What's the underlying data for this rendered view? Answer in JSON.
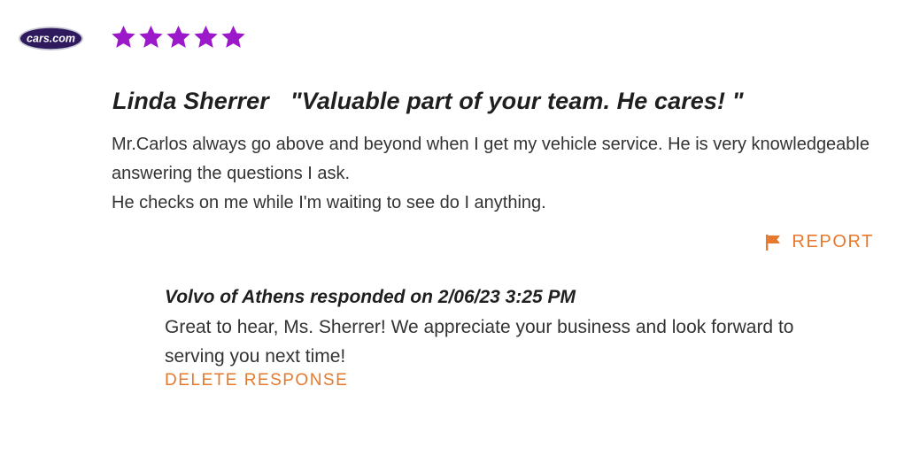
{
  "source_logo": {
    "text": "cars.com",
    "colors": {
      "ring": "#6d6d8a",
      "fill": "#2e1a5c",
      "text": "#ffffff"
    }
  },
  "rating": {
    "stars": 5,
    "max": 5,
    "color": "#9b19c9"
  },
  "review": {
    "author": "Linda Sherrer",
    "title": "\"Valuable part of your team. He cares! \"",
    "body_lines": [
      "Mr.Carlos always go above and beyond when I get my vehicle service. He is very knowledgeable answering the questions I ask.",
      "He checks on me while I'm waiting to see do I anything."
    ]
  },
  "report": {
    "label": "REPORT",
    "icon": "flag-icon",
    "color": "#e5792e"
  },
  "response": {
    "header": "Volvo of Athens responded on 2/06/23 3:25 PM",
    "body": "Great to hear, Ms. Sherrer!  We appreciate your business and look forward to serving you next time!",
    "delete_label": "DELETE RESPONSE"
  }
}
